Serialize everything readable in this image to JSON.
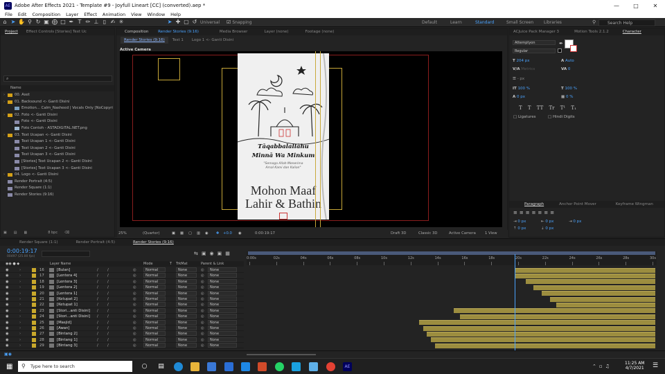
{
  "app": {
    "title": "Adobe After Effects 2021 - Template #9 - Joyfull Lineart [CC] (converted).aep *",
    "icon": "AE"
  },
  "menu": [
    "File",
    "Edit",
    "Composition",
    "Layer",
    "Effect",
    "Animation",
    "View",
    "Window",
    "Help"
  ],
  "toolbar": {
    "universal": "Universal",
    "snapping": "Snapping",
    "workspaces": [
      "Default",
      "Learn",
      "Standard",
      "Small Screen",
      "Libraries"
    ],
    "search_placeholder": "Search Help"
  },
  "project": {
    "tab": "Project",
    "effects_tab": "Effect Controls [Stories] Text Uc",
    "search": "⌕",
    "col_name": "Name",
    "items": [
      {
        "label": "00. Aset",
        "type": "folder",
        "indent": 0
      },
      {
        "label": "01. Backsound <- Ganti Disini",
        "type": "folder",
        "indent": 0
      },
      {
        "label": "Emotion... Calm_Nasheed | Vocals Only [NoCopyri",
        "type": "audio",
        "indent": 1
      },
      {
        "label": "02. Foto <- Ganti Disini",
        "type": "folder",
        "indent": 0
      },
      {
        "label": "Foto <- Ganti Disini",
        "type": "comp",
        "indent": 1
      },
      {
        "label": "Foto Contoh - ASTADIGITAL.NET.png",
        "type": "image",
        "indent": 1
      },
      {
        "label": "03. Text Ucapan <- Ganti Disini",
        "type": "folder",
        "indent": 0
      },
      {
        "label": "Text Ucapan 1 <- Ganti Disini",
        "type": "comp",
        "indent": 1
      },
      {
        "label": "Text Ucapan 2 <- Ganti Disini",
        "type": "comp",
        "indent": 1
      },
      {
        "label": "Text Ucapan 3 <- Ganti Disini",
        "type": "comp",
        "indent": 1
      },
      {
        "label": "[Stories] Text Ucapan 2 <- Ganti Disini",
        "type": "comp",
        "indent": 1
      },
      {
        "label": "[Stories] Text Ucapan 3 <- Ganti Disini",
        "type": "comp",
        "indent": 1
      },
      {
        "label": "04. Logo <- Ganti Disini",
        "type": "folder",
        "indent": 0
      },
      {
        "label": "Render Portrait (4:5)",
        "type": "comp",
        "indent": 0
      },
      {
        "label": "Render Square (1:1)",
        "type": "comp",
        "indent": 0
      },
      {
        "label": "Render Stories (9:16)",
        "type": "comp",
        "indent": 0
      }
    ],
    "bpc": "8 bpc"
  },
  "comp": {
    "tab_prefix": "Composition",
    "tab_name": "Render Stories (9:16)",
    "other_tabs": [
      "Media Browser",
      "Layer (none)",
      "Footage (none)"
    ],
    "breadcrumbs": [
      "Render Stories (9:16)",
      "Test 1",
      "Logo 1 <- Ganti Disini"
    ],
    "camera_label": "Active Camera",
    "art": {
      "line1": "Tāqabbalallāhu",
      "line2": "Minnā Wa Minkum",
      "sub1": "\"Semoga Allah Menerima",
      "sub2": "Amal Kami dan Kalian\"",
      "big1": "Mohon Maaf",
      "big2": "Lahir & Bathin"
    },
    "footer": {
      "zoom": "25%",
      "quality": "(Quarter)",
      "exposure": "+0.0",
      "time": "0:00:19:17",
      "renderer": "Draft 3D",
      "mode": "Classic 3D",
      "camera": "Active Camera",
      "views": "1 View"
    }
  },
  "right": {
    "tabs": [
      "ACJuice Pack Manager 3",
      "Motion Tools 2.1.2",
      "Character"
    ],
    "font": "Attemptyon",
    "style": "Regular",
    "size": "204 px",
    "leading": "Auto",
    "kerning": "Metrics",
    "tracking": "0",
    "vscale": "100 %",
    "hscale": "100 %",
    "baseline": "0 px",
    "tsume": "0 %",
    "stroke": "- px",
    "ligatures": "Ligatures",
    "hindi": "Hindi Digits",
    "para_tabs": [
      "Paragraph",
      "Anchor Point Mover",
      "Keyframe Wingman"
    ],
    "para_vals": [
      "0 px",
      "0 px",
      "0 px",
      "0 px",
      "0 px"
    ]
  },
  "timeline": {
    "tabs": [
      "Render Square (1:1)",
      "Render Portrait (4:5)",
      "Render Stories (9:16)"
    ],
    "timecode": "0:00:19:17",
    "fps": "00497 (25.00 fps)",
    "headers": {
      "layer": "Layer Name",
      "mode": "Mode",
      "t": "T",
      "trkmat": "TrkMat",
      "parent": "Parent & Link"
    },
    "ticks": [
      "0:00s",
      "02s",
      "04s",
      "06s",
      "08s",
      "10s",
      "12s",
      "14s",
      "16s",
      "18s",
      "20s",
      "22s",
      "24s",
      "26s",
      "28s",
      "30s"
    ],
    "layers": [
      {
        "num": "16",
        "name": "[Bulan]",
        "color": "#c9a82b",
        "start": 0.655
      },
      {
        "num": "17",
        "name": "[Lentera 4]",
        "color": "#c9a82b",
        "start": 0.655
      },
      {
        "num": "18",
        "name": "[Lentera 3]",
        "color": "#c9a82b",
        "start": 0.68
      },
      {
        "num": "19",
        "name": "[Lentera 2]",
        "color": "#c9a82b",
        "start": 0.7
      },
      {
        "num": "20",
        "name": "[Lentera 1]",
        "color": "#c9a82b",
        "start": 0.72
      },
      {
        "num": "21",
        "name": "[Ketupat 2]",
        "color": "#c9a82b",
        "start": 0.74
      },
      {
        "num": "22",
        "name": "[Ketupat 1]",
        "color": "#c9a82b",
        "start": 0.755
      },
      {
        "num": "23",
        "name": "[Stori...anti Disini]",
        "color": "#c9a82b",
        "start": 0.505
      },
      {
        "num": "24",
        "name": "[Stori...anti Disini]",
        "color": "#c9a82b",
        "start": 0.52
      },
      {
        "num": "25",
        "name": "[Masjid]",
        "color": "#c9a82b",
        "start": 0.42
      },
      {
        "num": "26",
        "name": "[Awan]",
        "color": "#c9a82b",
        "start": 0.43
      },
      {
        "num": "27",
        "name": "[Bintang 2]",
        "color": "#c9a82b",
        "start": 0.44
      },
      {
        "num": "28",
        "name": "[Bintang 1]",
        "color": "#c9a82b",
        "start": 0.45
      },
      {
        "num": "29",
        "name": "[Bintang 3]",
        "color": "#c9a82b",
        "start": 0.46
      }
    ],
    "mode_val": "Normal",
    "none_val": "None",
    "playhead": 0.654
  },
  "taskbar": {
    "search": "Type here to search",
    "time": "11:25 AM",
    "date": "4/7/2021"
  }
}
